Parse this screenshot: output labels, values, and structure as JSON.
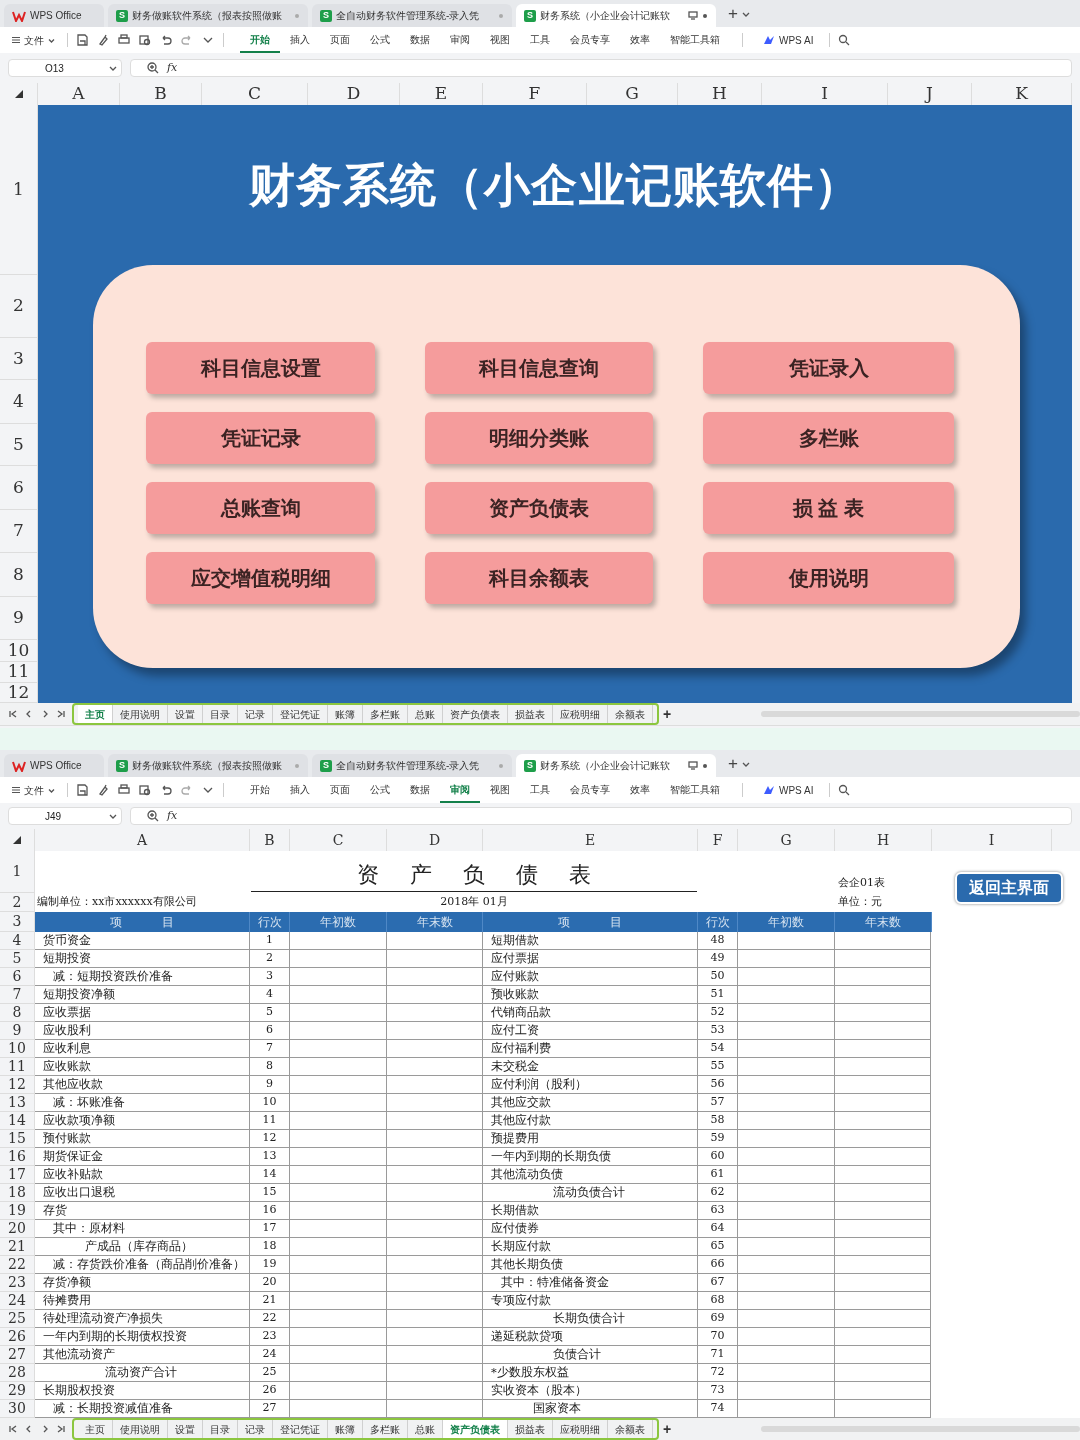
{
  "windows": [
    {
      "kind": "dashboard",
      "doc_tabs": [
        {
          "label": "WPS Office",
          "kind": "home",
          "selected": false
        },
        {
          "label": "财务做账软件系统（报表按照做账",
          "kind": "sheet",
          "badge": "S",
          "selected": false
        },
        {
          "label": "全自动财务软件管理系统-录入凭",
          "kind": "sheet",
          "badge": "S",
          "selected": false
        },
        {
          "label": "财务系统（小企业会计记账软",
          "kind": "sheet",
          "badge": "S",
          "selected": true
        }
      ],
      "new_tab": "+",
      "file_menu": "文件",
      "ribbon": [
        {
          "label": "开始",
          "selected": true
        },
        {
          "label": "插入",
          "selected": false
        },
        {
          "label": "页面",
          "selected": false
        },
        {
          "label": "公式",
          "selected": false
        },
        {
          "label": "数据",
          "selected": false
        },
        {
          "label": "审阅",
          "selected": false
        },
        {
          "label": "视图",
          "selected": false
        },
        {
          "label": "工具",
          "selected": false
        },
        {
          "label": "会员专享",
          "selected": false
        },
        {
          "label": "效率",
          "selected": false
        },
        {
          "label": "智能工具箱",
          "selected": false
        }
      ],
      "ai_label": "WPS AI",
      "name_box": "O13",
      "formula_label": "fx",
      "columns": [
        "A",
        "B",
        "C",
        "D",
        "E",
        "F",
        "G",
        "H",
        "I",
        "J",
        "K"
      ],
      "row_numbers": [
        "1",
        "2",
        "3",
        "4",
        "5",
        "6",
        "7",
        "8",
        "9",
        "10",
        "11",
        "12"
      ],
      "title": "财务系统（小企业记账软件）",
      "buttons": [
        "科目信息设置",
        "科目信息查询",
        "凭证录入",
        "凭证记录",
        "明细分类账",
        "多栏账",
        "总账查询",
        "资产负债表",
        "损 益 表",
        "应交增值税明细",
        "科目余额表",
        "使用说明"
      ],
      "sheet_tabs": [
        {
          "label": "主页",
          "selected": true
        },
        {
          "label": "使用说明",
          "selected": false
        },
        {
          "label": "设置",
          "selected": false
        },
        {
          "label": "目录",
          "selected": false
        },
        {
          "label": "记录",
          "selected": false
        },
        {
          "label": "登记凭证",
          "selected": false
        },
        {
          "label": "账簿",
          "selected": false
        },
        {
          "label": "多栏账",
          "selected": false
        },
        {
          "label": "总账",
          "selected": false
        },
        {
          "label": "资产负债表",
          "selected": false
        },
        {
          "label": "损益表",
          "selected": false
        },
        {
          "label": "应税明细",
          "selected": false
        },
        {
          "label": "余额表",
          "selected": false
        }
      ],
      "add_sheet": "+"
    },
    {
      "kind": "balance_sheet",
      "doc_tabs": [
        {
          "label": "WPS Office",
          "kind": "home",
          "selected": false
        },
        {
          "label": "财务做账软件系统（报表按照做账",
          "kind": "sheet",
          "badge": "S",
          "selected": false
        },
        {
          "label": "全自动财务软件管理系统-录入凭",
          "kind": "sheet",
          "badge": "S",
          "selected": false
        },
        {
          "label": "财务系统（小企业会计记账软",
          "kind": "sheet",
          "badge": "S",
          "selected": true
        }
      ],
      "new_tab": "+",
      "file_menu": "文件",
      "ribbon": [
        {
          "label": "开始",
          "selected": false
        },
        {
          "label": "插入",
          "selected": false
        },
        {
          "label": "页面",
          "selected": false
        },
        {
          "label": "公式",
          "selected": false
        },
        {
          "label": "数据",
          "selected": false
        },
        {
          "label": "审阅",
          "selected": true
        },
        {
          "label": "视图",
          "selected": false
        },
        {
          "label": "工具",
          "selected": false
        },
        {
          "label": "会员专享",
          "selected": false
        },
        {
          "label": "效率",
          "selected": false
        },
        {
          "label": "智能工具箱",
          "selected": false
        }
      ],
      "ai_label": "WPS AI",
      "name_box": "J49",
      "formula_label": "fx",
      "columns": [
        "A",
        "B",
        "C",
        "D",
        "E",
        "F",
        "G",
        "H",
        "I"
      ],
      "row_numbers": [
        "1",
        "2",
        "3",
        "4",
        "5",
        "6",
        "7",
        "8",
        "9",
        "10",
        "11",
        "12",
        "13",
        "14",
        "15",
        "16",
        "17",
        "18",
        "19",
        "20",
        "21",
        "22",
        "23",
        "24",
        "25",
        "26",
        "27",
        "28",
        "29",
        "30"
      ],
      "title": "资 产 负 债 表",
      "form_code": "会企01表",
      "company": "编制单位：xx市xxxxxx有限公司",
      "period": "2018年 01月",
      "unit": "单位：元",
      "back_button": "返回主界面",
      "table": {
        "columns": [
          "项 目",
          "行次",
          "年初数",
          "年末数",
          "项 目",
          "行次",
          "年初数",
          "年末数"
        ],
        "rows": [
          {
            "left": {
              "item": "货币资金",
              "line": "1",
              "kind": "item"
            },
            "right": {
              "item": "短期借款",
              "line": "48",
              "kind": "item"
            }
          },
          {
            "left": {
              "item": "短期投资",
              "line": "2",
              "kind": "item"
            },
            "right": {
              "item": "应付票据",
              "line": "49",
              "kind": "item"
            }
          },
          {
            "left": {
              "item": "减：短期投资跌价准备",
              "line": "3",
              "kind": "sub"
            },
            "right": {
              "item": "应付账款",
              "line": "50",
              "kind": "item"
            }
          },
          {
            "left": {
              "item": "短期投资净额",
              "line": "4",
              "kind": "item"
            },
            "right": {
              "item": "预收账款",
              "line": "51",
              "kind": "item"
            }
          },
          {
            "left": {
              "item": "应收票据",
              "line": "5",
              "kind": "item"
            },
            "right": {
              "item": "代销商品款",
              "line": "52",
              "kind": "item"
            }
          },
          {
            "left": {
              "item": "应收股利",
              "line": "6",
              "kind": "item"
            },
            "right": {
              "item": "应付工资",
              "line": "53",
              "kind": "item"
            }
          },
          {
            "left": {
              "item": "应收利息",
              "line": "7",
              "kind": "item"
            },
            "right": {
              "item": "应付福利费",
              "line": "54",
              "kind": "item"
            }
          },
          {
            "left": {
              "item": "应收账款",
              "line": "8",
              "kind": "item"
            },
            "right": {
              "item": "未交税金",
              "line": "55",
              "kind": "item"
            }
          },
          {
            "left": {
              "item": "其他应收款",
              "line": "9",
              "kind": "item"
            },
            "right": {
              "item": "应付利润（股利）",
              "line": "56",
              "kind": "item"
            }
          },
          {
            "left": {
              "item": "减：坏账准备",
              "line": "10",
              "kind": "sub"
            },
            "right": {
              "item": "其他应交款",
              "line": "57",
              "kind": "item"
            }
          },
          {
            "left": {
              "item": "应收款项净额",
              "line": "11",
              "kind": "item"
            },
            "right": {
              "item": "其他应付款",
              "line": "58",
              "kind": "item"
            }
          },
          {
            "left": {
              "item": "预付账款",
              "line": "12",
              "kind": "item"
            },
            "right": {
              "item": "预提费用",
              "line": "59",
              "kind": "item"
            }
          },
          {
            "left": {
              "item": "期货保证金",
              "line": "13",
              "kind": "item"
            },
            "right": {
              "item": "一年内到期的长期负债",
              "line": "60",
              "kind": "item"
            }
          },
          {
            "left": {
              "item": "应收补贴款",
              "line": "14",
              "kind": "item"
            },
            "right": {
              "item": "其他流动负债",
              "line": "61",
              "kind": "item"
            }
          },
          {
            "left": {
              "item": "应收出口退税",
              "line": "15",
              "kind": "item"
            },
            "right": {
              "item": "流动负债合计",
              "line": "62",
              "kind": "total"
            }
          },
          {
            "left": {
              "item": "存货",
              "line": "16",
              "kind": "item"
            },
            "right": {
              "item": "长期借款",
              "line": "63",
              "kind": "item"
            }
          },
          {
            "left": {
              "item": "其中：原材料",
              "line": "17",
              "kind": "sub"
            },
            "right": {
              "item": "应付债券",
              "line": "64",
              "kind": "item"
            }
          },
          {
            "left": {
              "item": "产成品（库存商品）",
              "line": "18",
              "kind": "deep"
            },
            "right": {
              "item": "长期应付款",
              "line": "65",
              "kind": "item"
            }
          },
          {
            "left": {
              "item": "减：存货跌价准备（商品削价准备）",
              "line": "19",
              "kind": "sub"
            },
            "right": {
              "item": "其他长期负债",
              "line": "66",
              "kind": "item"
            }
          },
          {
            "left": {
              "item": "存货净额",
              "line": "20",
              "kind": "item"
            },
            "right": {
              "item": "其中：特准储备资金",
              "line": "67",
              "kind": "sub"
            }
          },
          {
            "left": {
              "item": "待摊费用",
              "line": "21",
              "kind": "item"
            },
            "right": {
              "item": "专项应付款",
              "line": "68",
              "kind": "item"
            }
          },
          {
            "left": {
              "item": "待处理流动资产净损失",
              "line": "22",
              "kind": "item"
            },
            "right": {
              "item": "长期负债合计",
              "line": "69",
              "kind": "total"
            }
          },
          {
            "left": {
              "item": "一年内到期的长期债权投资",
              "line": "23",
              "kind": "item"
            },
            "right": {
              "item": "递延税款贷项",
              "line": "70",
              "kind": "item"
            }
          },
          {
            "left": {
              "item": "其他流动资产",
              "line": "24",
              "kind": "item"
            },
            "right": {
              "item": "负债合计",
              "line": "71",
              "kind": "total"
            }
          },
          {
            "left": {
              "item": "流动资产合计",
              "line": "25",
              "kind": "total"
            },
            "right": {
              "item": "*少数股东权益",
              "line": "72",
              "kind": "item"
            }
          },
          {
            "left": {
              "item": "长期股权投资",
              "line": "26",
              "kind": "item"
            },
            "right": {
              "item": "实收资本（股本）",
              "line": "73",
              "kind": "item"
            }
          },
          {
            "left": {
              "item": "减：长期投资减值准备",
              "line": "27",
              "kind": "sub"
            },
            "right": {
              "item": "国家资本",
              "line": "74",
              "kind": "deep"
            }
          }
        ]
      },
      "sheet_tabs": [
        {
          "label": "主页",
          "selected": false
        },
        {
          "label": "使用说明",
          "selected": false
        },
        {
          "label": "设置",
          "selected": false
        },
        {
          "label": "目录",
          "selected": false
        },
        {
          "label": "记录",
          "selected": false
        },
        {
          "label": "登记凭证",
          "selected": false
        },
        {
          "label": "账簿",
          "selected": false
        },
        {
          "label": "多栏账",
          "selected": false
        },
        {
          "label": "总账",
          "selected": false
        },
        {
          "label": "资产负债表",
          "selected": true
        },
        {
          "label": "损益表",
          "selected": false
        },
        {
          "label": "应税明细",
          "selected": false
        },
        {
          "label": "余额表",
          "selected": false
        }
      ],
      "add_sheet": "+"
    }
  ]
}
